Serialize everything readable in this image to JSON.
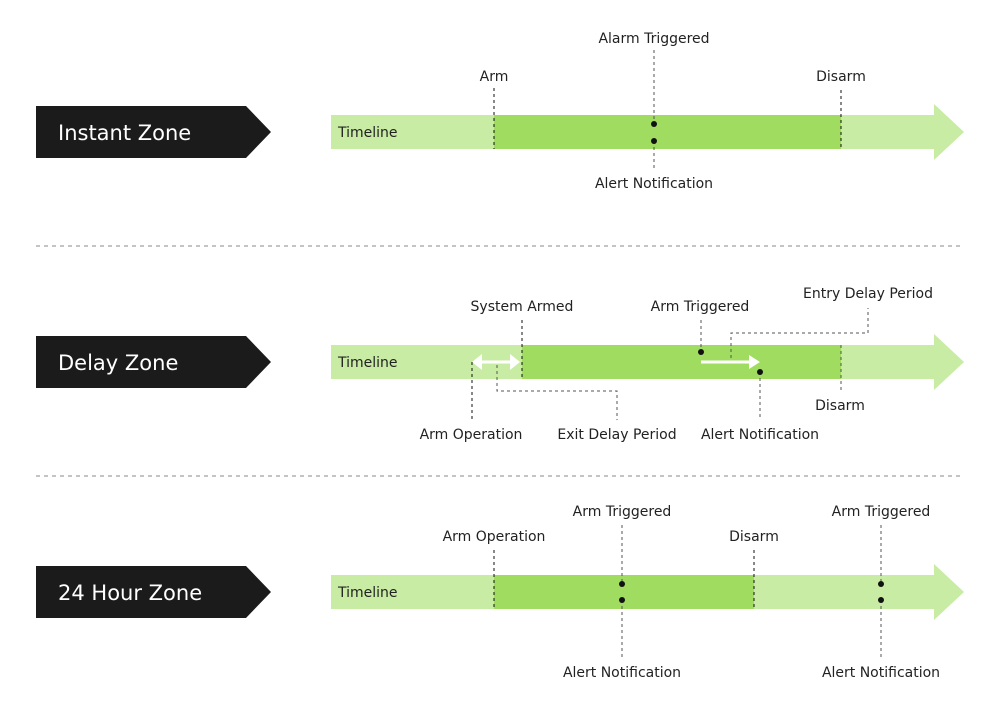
{
  "colors": {
    "zone_tag": "#1b1b1b",
    "timeline_light": "#c8eca4",
    "timeline_active": "#a0dc60",
    "marker": "#111111",
    "divider": "#888888",
    "arrow": "#ffffff"
  },
  "zones": [
    {
      "name": "Instant Zone",
      "timeline_label": "Timeline",
      "annotations": {
        "arm": "Arm",
        "alarm_triggered": "Alarm Triggered",
        "disarm": "Disarm",
        "alert_notification": "Alert Notification"
      }
    },
    {
      "name": "Delay Zone",
      "timeline_label": "Timeline",
      "annotations": {
        "system_armed": "System Armed",
        "arm_triggered": "Arm Triggered",
        "entry_delay_period": "Entry Delay Period",
        "arm_operation": "Arm Operation",
        "exit_delay_period": "Exit Delay Period",
        "alert_notification": "Alert Notification",
        "disarm": "Disarm"
      }
    },
    {
      "name": "24 Hour Zone",
      "timeline_label": "Timeline",
      "annotations": {
        "arm_operation": "Arm Operation",
        "arm_triggered_1": "Arm Triggered",
        "disarm": "Disarm",
        "arm_triggered_2": "Arm Triggered",
        "alert_notification_1": "Alert Notification",
        "alert_notification_2": "Alert Notification"
      }
    }
  ]
}
